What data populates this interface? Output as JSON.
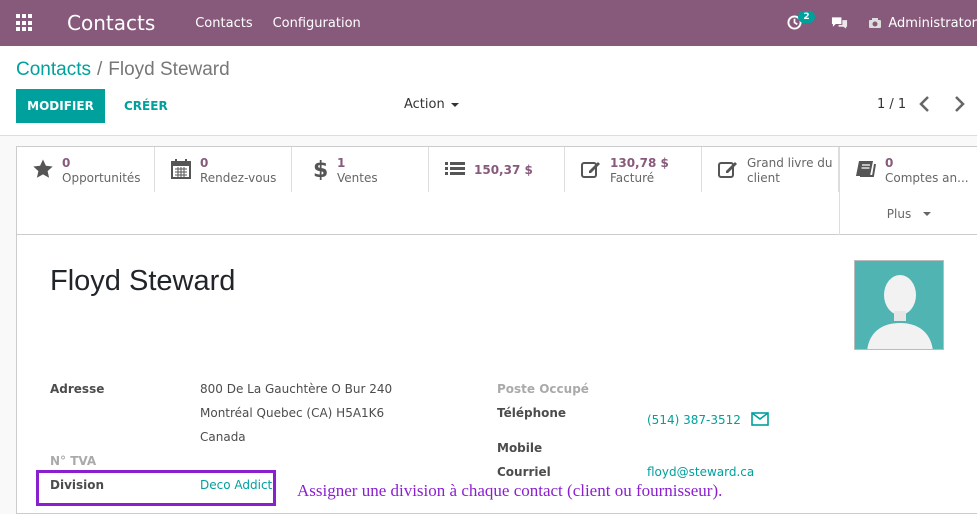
{
  "navbar": {
    "app_title": "Contacts",
    "menu": [
      "Contacts",
      "Configuration"
    ],
    "activity_count": "2",
    "user_name": "Administrator"
  },
  "breadcrumb": {
    "parent": "Contacts",
    "separator": "/",
    "current": "Floyd Steward"
  },
  "toolbar": {
    "edit_label": "MODIFIER",
    "create_label": "CRÉER",
    "action_label": "Action",
    "pager": "1 / 1"
  },
  "stats": [
    {
      "value": "0",
      "label": "Opportunités",
      "icon": "star-icon"
    },
    {
      "value": "0",
      "label": "Rendez-vous",
      "icon": "calendar-icon"
    },
    {
      "value": "1",
      "label": "Ventes",
      "icon": "dollar-icon"
    },
    {
      "value": "150,37 $",
      "label": "",
      "icon": "list-icon"
    },
    {
      "value": "130,78 $",
      "label": "Facturé",
      "icon": "edit-icon"
    },
    {
      "value": "",
      "label": "Grand livre du client",
      "icon": "edit-icon"
    },
    {
      "value": "0",
      "label": "Comptes an...",
      "icon": "book-icon"
    }
  ],
  "more_label": "Plus",
  "partner": {
    "name": "Floyd Steward",
    "address_label": "Adresse",
    "address_line1": "800 De La Gauchtère O Bur 240",
    "address_line2": "Montréal  Quebec (CA)  H5A1K6",
    "address_line3": "Canada",
    "vat_label": "N° TVA",
    "division_label": "Division",
    "division_value": "Deco Addict",
    "job_label": "Poste Occupé",
    "phone_label": "Téléphone",
    "phone_value": "(514) 387-3512",
    "mobile_label": "Mobile",
    "email_label": "Courriel",
    "email_value": "floyd@steward.ca"
  },
  "annotation": "Assigner une division à chaque contact (client ou fournisseur).",
  "colors": {
    "brand": "#875a7b",
    "accent": "#00a09d",
    "annotation": "#8a1fcf"
  }
}
